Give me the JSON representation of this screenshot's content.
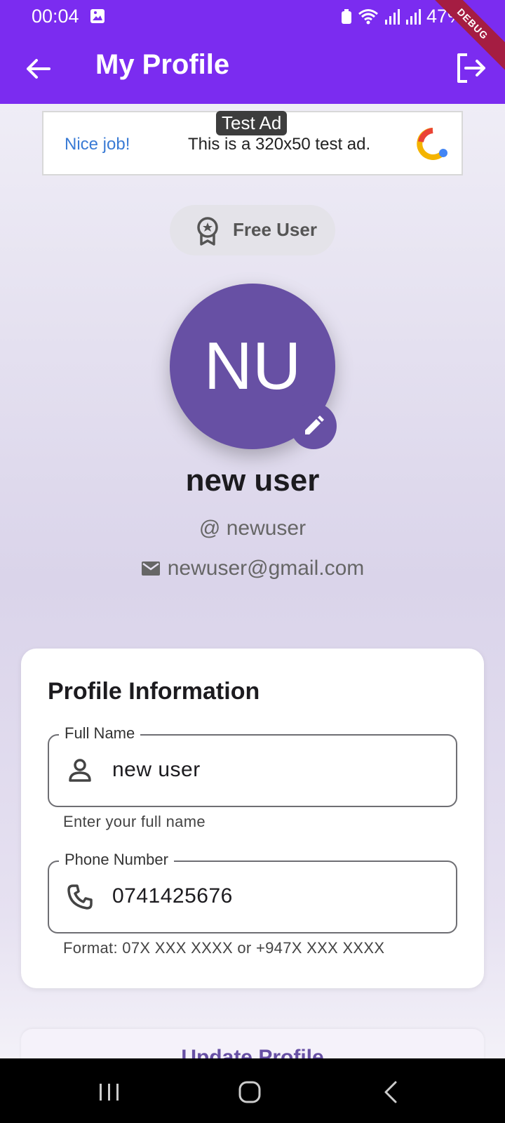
{
  "status_bar": {
    "time": "00:04",
    "battery": "47%",
    "debug_banner": "DEBUG"
  },
  "app_bar": {
    "title": "My Profile"
  },
  "ad": {
    "tag": "Test Ad",
    "nice": "Nice job!",
    "message": "This is a 320x50 test ad."
  },
  "badge": {
    "label": "Free User"
  },
  "profile": {
    "initials": "NU",
    "name": "new user",
    "username": "@ newuser",
    "email": "newuser@gmail.com"
  },
  "card": {
    "heading": "Profile Information",
    "full_name": {
      "label": "Full Name",
      "value": "new user",
      "helper": "Enter your full name"
    },
    "phone": {
      "label": "Phone Number",
      "value": "0741425676",
      "helper": "Format: 07X XXX XXXX or +947X XXX XXXX"
    }
  },
  "update_button": {
    "label": "Update Profile"
  },
  "colors": {
    "primary": "#7b2cf0",
    "avatar": "#6750a4",
    "debug": "#a51d42"
  }
}
